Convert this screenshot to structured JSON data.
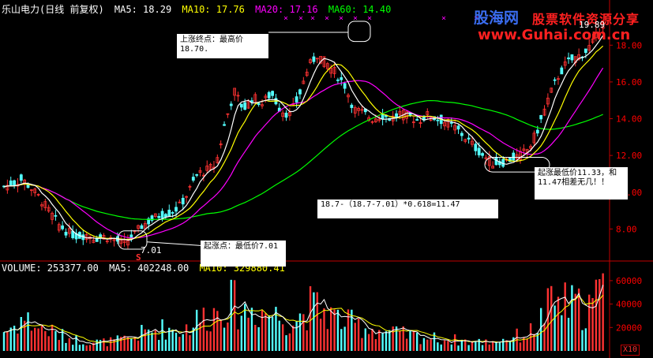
{
  "header": {
    "title": "乐山电力(日线 前复权)",
    "ma5": "MA5: 18.29",
    "ma10": "MA10: 17.76",
    "ma20": "MA20: 17.16",
    "ma60": "MA60: 14.40"
  },
  "volume_header": {
    "volume": "VOLUME: 253377.00",
    "ma5": "MA5: 402248.00",
    "ma10": "MA10: 329880.41"
  },
  "watermark": {
    "brand": "股海网",
    "slogan": "股票软件资源分享",
    "url": "www.Guhai.com.cn"
  },
  "annotations": {
    "top_note_line1": "上涨终点：最高价",
    "top_note_line2": "18.70.",
    "bottom_note": "起涨点：最低价7.01",
    "low_note_line1": "起涨最低价11.33，和",
    "low_note_line2": "11.47相差无几！！",
    "formula": "18.7-（18.7-7.01）*0.618=11.47",
    "low_label": "7.01",
    "high_label": "19.89",
    "s_marker": "S",
    "zoom_label": "X10"
  },
  "colors": {
    "background": "#000000",
    "up_candle": "#ff3232",
    "down_candle": "#54ffff",
    "ma5": "#ffffff",
    "ma10": "#ffff00",
    "ma20": "#ff00ff",
    "ma60": "#00ff00",
    "axis": "#c00000",
    "tick_text": "#ff0000",
    "title_text": "#ffffff"
  },
  "chart_data": [
    {
      "type": "candlestick",
      "title": "乐山电力(日线 前复权)",
      "ylim": [
        6.3,
        19.6
      ],
      "y_ticks": [
        8.0,
        10.0,
        12.0,
        14.0,
        16.0,
        18.0
      ],
      "y_tick_labels": [
        "8.00",
        "10.00",
        "12.00",
        "14.00",
        "16.00",
        "18.00"
      ],
      "key_points": [
        {
          "label": "low",
          "value": 7.01
        },
        {
          "label": "high",
          "value": 18.7
        },
        {
          "label": "second_low",
          "value": 11.33
        },
        {
          "label": "fib_0.618",
          "value": 11.47
        },
        {
          "label": "last_high",
          "value": 19.89
        }
      ],
      "close_path": [
        10.3,
        10.5,
        10.7,
        10.2,
        9.6,
        8.9,
        8.2,
        7.8,
        7.6,
        7.7,
        7.5,
        7.6,
        7.4,
        7.2,
        7.6,
        8.2,
        8.5,
        8.8,
        8.9,
        9.2,
        10.0,
        11.0,
        11.2,
        11.5,
        13.8,
        15.5,
        14.5,
        15.2,
        14.8,
        15.4,
        14.5,
        14.2,
        15.2,
        16.8,
        17.5,
        17.0,
        16.5,
        15.8,
        14.5,
        14.3,
        14.0,
        14.2,
        14.0,
        14.3,
        14.1,
        13.9,
        14.2,
        14.0,
        13.8,
        13.5,
        13.0,
        12.5,
        12.0,
        11.6,
        11.6,
        11.8,
        12.0,
        12.4,
        13.5,
        15.0,
        16.2,
        17.0,
        17.3,
        17.6,
        18.2,
        19.2
      ],
      "series": [
        {
          "name": "MA5",
          "last": 18.29
        },
        {
          "name": "MA10",
          "last": 17.76
        },
        {
          "name": "MA20",
          "last": 17.16
        },
        {
          "name": "MA60",
          "last": 14.4
        }
      ]
    },
    {
      "type": "bar",
      "title": "VOLUME",
      "ylim": [
        0,
        66000
      ],
      "y_ticks": [
        20000,
        40000,
        60000
      ],
      "y_tick_labels": [
        "20000",
        "40000",
        "60000"
      ],
      "volume_path": [
        18,
        22,
        30,
        25,
        20,
        18,
        14,
        12,
        10,
        9,
        8,
        8,
        9,
        10,
        12,
        16,
        18,
        20,
        20,
        18,
        22,
        28,
        32,
        35,
        45,
        42,
        35,
        38,
        36,
        34,
        30,
        28,
        30,
        40,
        38,
        35,
        30,
        26,
        24,
        22,
        20,
        18,
        16,
        15,
        14,
        13,
        12,
        11,
        10,
        10,
        9,
        8,
        8,
        9,
        10,
        12,
        14,
        16,
        25,
        38,
        44,
        42,
        40,
        38,
        44,
        55
      ],
      "series": [
        {
          "name": "VOLUME",
          "last": 253377.0
        },
        {
          "name": "MA5",
          "last": 402248.0
        },
        {
          "name": "MA10",
          "last": 329880.41
        }
      ]
    }
  ]
}
